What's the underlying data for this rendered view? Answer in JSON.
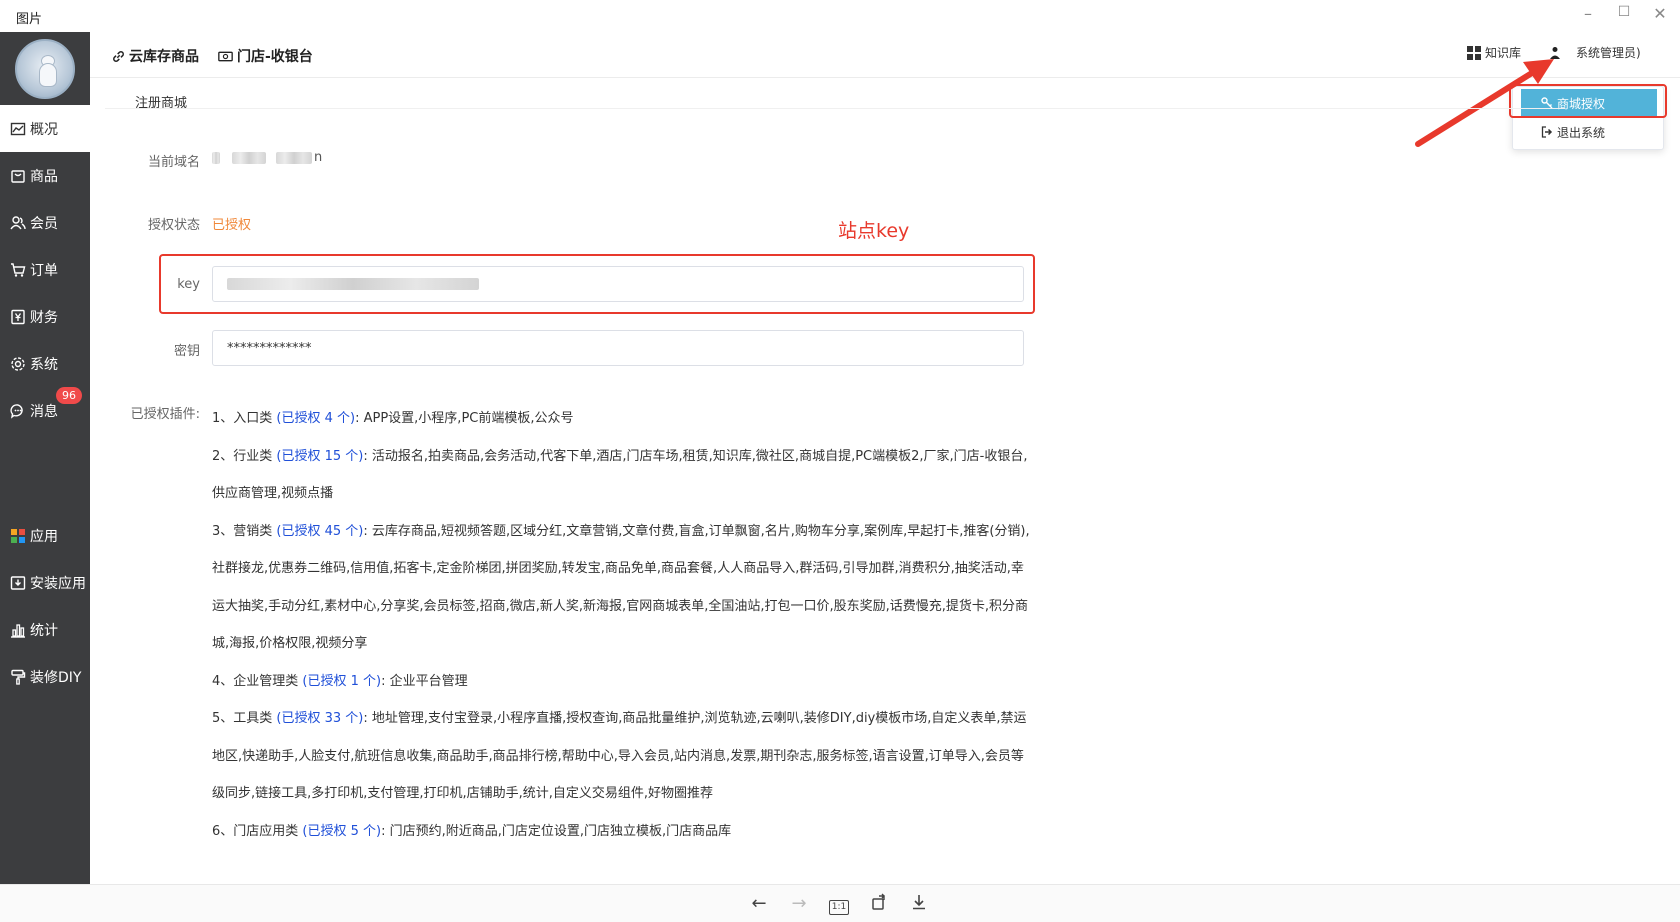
{
  "window": {
    "title": "图片"
  },
  "sidebar": {
    "items": [
      {
        "label": "概况",
        "icon": "chart-line-icon",
        "active": true
      },
      {
        "label": "商品",
        "icon": "shopping-bag-icon"
      },
      {
        "label": "会员",
        "icon": "users-icon"
      },
      {
        "label": "订单",
        "icon": "cart-icon"
      },
      {
        "label": "财务",
        "icon": "finance-icon"
      },
      {
        "label": "系统",
        "icon": "gear-icon"
      },
      {
        "label": "消息",
        "icon": "chat-icon"
      },
      {
        "label": "应用",
        "icon": "apps-grid-icon"
      },
      {
        "label": "安装应用",
        "icon": "download-icon"
      },
      {
        "label": "统计",
        "icon": "bar-chart-icon"
      },
      {
        "label": "装修DIY",
        "icon": "paint-roller-icon"
      }
    ],
    "message_badge": "96"
  },
  "topbar": {
    "tabs": [
      {
        "label": "云库存商品",
        "icon": "link-icon"
      },
      {
        "label": "门店-收银台",
        "icon": "cash-register-icon"
      }
    ],
    "knowledge_label": "知识库",
    "user_label": "系统管理员)"
  },
  "dropdown": {
    "items": [
      {
        "label": "商城授权",
        "icon": "key-icon",
        "selected": true
      },
      {
        "label": "退出系统",
        "icon": "logout-icon"
      }
    ]
  },
  "page": {
    "section_title": "注册商城",
    "domain_label": "当前域名",
    "domain_tail": "n",
    "status_label": "授权状态",
    "status_value": "已授权",
    "key_label": "key",
    "secret_label": "密钥",
    "secret_value": "*************",
    "annotation": "站点key",
    "plugins_label": "已授权插件:",
    "plugins": [
      {
        "prefix": "1、入口类 ",
        "count": "(已授权 4 个)",
        "list": ": APP设置,小程序,PC前端模板,公众号"
      },
      {
        "prefix": "2、行业类 ",
        "count": "(已授权 15 个)",
        "list": ": 活动报名,拍卖商品,会务活动,代客下单,酒店,门店车场,租赁,知识库,微社区,商城自提,PC端模板2,厂家,门店-收银台,供应商管理,视频点播"
      },
      {
        "prefix": "3、营销类 ",
        "count": "(已授权 45 个)",
        "list": ": 云库存商品,短视频答题,区域分红,文章营销,文章付费,盲盒,订单飘窗,名片,购物车分享,案例库,早起打卡,推客(分销),社群接龙,优惠券二维码,信用值,拓客卡,定金阶梯团,拼团奖励,转发宝,商品免单,商品套餐,人人商品导入,群活码,引导加群,消费积分,抽奖活动,幸运大抽奖,手动分红,素材中心,分享奖,会员标签,招商,微店,新人奖,新海报,官网商城表单,全国油站,打包一口价,股东奖励,话费慢充,提货卡,积分商城,海报,价格权限,视频分享"
      },
      {
        "prefix": "4、企业管理类 ",
        "count": "(已授权 1 个)",
        "list": ": 企业平台管理"
      },
      {
        "prefix": "5、工具类 ",
        "count": "(已授权 33 个)",
        "list": ": 地址管理,支付宝登录,小程序直播,授权查询,商品批量维护,浏览轨迹,云喇叭,装修DIY,diy模板市场,自定义表单,禁运地区,快递助手,人脸支付,航班信息收集,商品助手,商品排行榜,帮助中心,导入会员,站内消息,发票,期刊杂志,服务标签,语言设置,订单导入,会员等级同步,链接工具,多打印机,支付管理,打印机,店铺助手,统计,自定义交易组件,好物圈推荐"
      },
      {
        "prefix": "6、门店应用类 ",
        "count": "(已授权 5 个)",
        "list": ": 门店预约,附近商品,门店定位设置,门店独立模板,门店商品库"
      }
    ]
  },
  "viewer": {
    "zoom_label": "1:1"
  },
  "colors": {
    "sidebar_bg": "#3c3d3f",
    "accent_red": "#e8392c",
    "status_orange": "#f0883a",
    "plugin_blue": "#1f4fd8",
    "dropdown_sel": "#52b3d9"
  }
}
